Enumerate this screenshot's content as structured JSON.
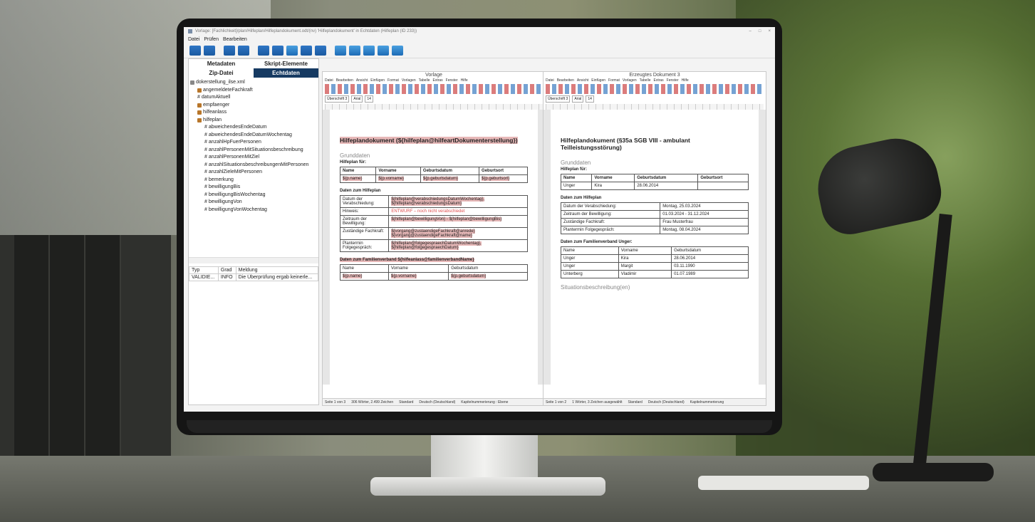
{
  "window": {
    "title": "Vorlage: [Fachlichkeit]/plan/Hilfeplan/Hilfeplandokument.odt/(nv) 'Hilfeplandokument' in Echtdaten (Hilfeplan (ID 233))",
    "controls": [
      "–",
      "□",
      "×"
    ]
  },
  "menu": [
    "Datei",
    "Prüfen",
    "Bearbeiten"
  ],
  "left_panel": {
    "tabs": [
      "Metadaten",
      "Skript-Elemente",
      "Zip-Datei",
      "Echtdaten"
    ],
    "tree": [
      {
        "label": "dokerstellung_ilse.xml",
        "level": 0,
        "type": "file"
      },
      {
        "label": "angemeldeteFachkraft",
        "level": 1,
        "type": "group"
      },
      {
        "label": "datumAktuell",
        "level": 1,
        "type": "field"
      },
      {
        "label": "empfaenger",
        "level": 1,
        "type": "group"
      },
      {
        "label": "hilfeanlass",
        "level": 1,
        "type": "group"
      },
      {
        "label": "hilfeplan",
        "level": 1,
        "type": "group"
      },
      {
        "label": "abweichendesEndeDatum",
        "level": 2,
        "type": "field"
      },
      {
        "label": "abweichendesEndeDatumWochentag",
        "level": 2,
        "type": "field"
      },
      {
        "label": "anzahlHpFuerPersonen",
        "level": 2,
        "type": "field"
      },
      {
        "label": "anzahlPersonenMitSituationsbeschreibung",
        "level": 2,
        "type": "field"
      },
      {
        "label": "anzahlPersonenMitZiel",
        "level": 2,
        "type": "field"
      },
      {
        "label": "anzahlSituationsbeschreibungenMitPersonen",
        "level": 2,
        "type": "field"
      },
      {
        "label": "anzahlZieleMitPersonen",
        "level": 2,
        "type": "field"
      },
      {
        "label": "bemerkung",
        "level": 2,
        "type": "field"
      },
      {
        "label": "bewilligungBis",
        "level": 2,
        "type": "field"
      },
      {
        "label": "bewilligungBisWochentag",
        "level": 2,
        "type": "field"
      },
      {
        "label": "bewilligungVon",
        "level": 2,
        "type": "field"
      },
      {
        "label": "bewilligungVonWochentag",
        "level": 2,
        "type": "field"
      }
    ],
    "messages": {
      "headers": [
        "Typ",
        "Grad",
        "Meldung"
      ],
      "rows": [
        [
          "VALIDIE...",
          "INFO",
          "Die Überprüfung ergab keinerle..."
        ]
      ]
    }
  },
  "doc_left": {
    "title": "Vorlage",
    "menu": [
      "Datei",
      "Bearbeiten",
      "Ansicht",
      "Einfügen",
      "Format",
      "Vorlagen",
      "Tabelle",
      "Extras",
      "Fenster",
      "Hilfe"
    ],
    "style": "Überschrift 3",
    "font": "Arial",
    "size": "14",
    "heading": "Hilfeplandokument (${hilfeplan@hilfeartDokumenterstellung})",
    "grunddaten": "Grunddaten",
    "hilfeplan_fuer": "Hilfeplan für:",
    "person_table": {
      "headers": [
        "Name",
        "Vorname",
        "Geburtsdatum",
        "Geburtsort"
      ],
      "row": [
        "${p.name}",
        "${p.vorname}",
        "${p.geburtsdatum}",
        "${p.geburtsort}"
      ]
    },
    "daten_zum_hilfeplan": "Daten zum Hilfeplan",
    "hilfeplan_rows": [
      [
        "Datum der Verabschiedung:",
        "${hilfeplan@verabschiedungsDatumWochentag}, ${hilfeplan@verabschiedungsDatum}"
      ],
      [
        "Hinweis:",
        "ENTWURF – noch nicht verabschiedet"
      ],
      [
        "Zeitraum der Bewilligung:",
        "${hilfeplan@bewilligungVon} - ${hilfeplan@bewilligungBis}"
      ],
      [
        "Zuständige Fachkraft:",
        "${vorgang@zustaendigeFachkraft@anrede} ${vorgang@zustaendigeFachkraft@name}"
      ],
      [
        "Plantermin Folgegespräch:",
        "${hilfeplan@folgegespraechDatumWochentag}, ${hilfeplan@folgegespraechDatum}"
      ]
    ],
    "familie_heading": "Daten zum Familienverband ${hilfeanlass@familienverbandName}",
    "familie_table": {
      "headers": [
        "Name",
        "Vorname",
        "Geburtsdatum"
      ],
      "row": [
        "${p.name}",
        "${p.vorname}",
        "${p.geburtsdatum}"
      ]
    },
    "status": [
      "Seite 1 von 3",
      "306 Wörter, 2.499 Zeichen",
      "Standard",
      "Deutsch (Deutschland)",
      "Kapitelnummerierung : Ebene"
    ]
  },
  "doc_right": {
    "title": "Erzeugtes Dokument 3",
    "menu": [
      "Datei",
      "Bearbeiten",
      "Ansicht",
      "Einfügen",
      "Format",
      "Vorlagen",
      "Tabelle",
      "Extras",
      "Fenster",
      "Hilfe"
    ],
    "style": "Überschrift 3",
    "font": "Arial",
    "size": "14",
    "heading": "Hilfeplandokument (§35a SGB VIII - ambulant Teilleistungsstörung)",
    "grunddaten": "Grunddaten",
    "hilfeplan_fuer": "Hilfeplan für:",
    "person_table": {
      "headers": [
        "Name",
        "Vorname",
        "Geburtsdatum",
        "Geburtsort"
      ],
      "row": [
        "Unger",
        "Kira",
        "28.06.2014",
        ""
      ]
    },
    "daten_zum_hilfeplan": "Daten zum Hilfeplan",
    "hilfeplan_rows": [
      [
        "Datum der Verabschiedung:",
        "Montag, 25.03.2024"
      ],
      [
        "Zeitraum der Bewilligung:",
        "01.03.2024 - 31.12.2024"
      ],
      [
        "Zuständige Fachkraft:",
        "Frau Musterfrau"
      ],
      [
        "Plantermin Folgegespräch:",
        "Montag, 08.04.2024"
      ]
    ],
    "familie_heading": "Daten zum Familienverband Unger:",
    "familie_table": {
      "headers": [
        "Name",
        "Vorname",
        "Geburtsdatum"
      ],
      "rows": [
        [
          "Unger",
          "Kira",
          "28.06.2014"
        ],
        [
          "Unger",
          "Margit",
          "03.11.1990"
        ],
        [
          "Unterberg",
          "Vladimir",
          "01.07.1989"
        ]
      ]
    },
    "situation_heading": "Situationsbeschreibung(en)",
    "status": [
      "Seite 1 von 2",
      "1 Wörter, 3 Zeichen ausgewählt",
      "Standard",
      "Deutsch (Deutschland)",
      "Kapitelnummerierung"
    ]
  }
}
